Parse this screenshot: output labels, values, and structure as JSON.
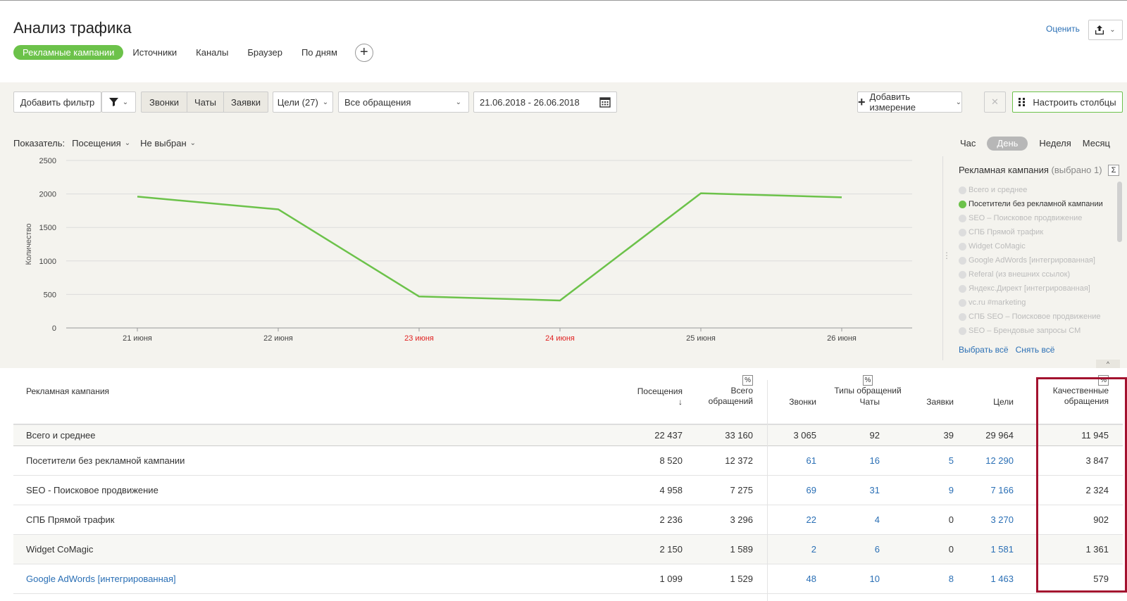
{
  "page": {
    "title": "Анализ трафика",
    "rate_label": "Оценить"
  },
  "tabs": [
    {
      "label": "Рекламные кампании",
      "active": true
    },
    {
      "label": "Источники"
    },
    {
      "label": "Каналы"
    },
    {
      "label": "Браузер"
    },
    {
      "label": "По дням"
    }
  ],
  "toolbar": {
    "add_filter": "Добавить фильтр",
    "segments": [
      "Звонки",
      "Чаты",
      "Заявки"
    ],
    "goals": "Цели (27)",
    "all_requests": "Все обращения",
    "date_range": "21.06.2018 - 26.06.2018",
    "add_dimension": "Добавить измерение",
    "configure_columns": "Настроить столбцы"
  },
  "indicator": {
    "label": "Показатель:",
    "metric1": "Посещения",
    "metric2": "Не выбран"
  },
  "periods": [
    "Час",
    "День",
    "Неделя",
    "Месяц"
  ],
  "active_period": "День",
  "chart_data": {
    "type": "line",
    "ylabel": "Количество",
    "ylim": [
      0,
      2500
    ],
    "yticks": [
      0,
      500,
      1000,
      1500,
      2000,
      2500
    ],
    "categories": [
      "21 июня",
      "22 июня",
      "23 июня",
      "24 июня",
      "25 июня",
      "26 июня"
    ],
    "weekend_categories": [
      "23 июня",
      "24 июня"
    ],
    "series": [
      {
        "name": "Посетители без рекламной кампании",
        "color": "#6cc24a",
        "values": [
          1960,
          1770,
          470,
          410,
          2010,
          1950
        ]
      }
    ],
    "grid": true,
    "legend_position": "right"
  },
  "legend": {
    "title": "Рекламная кампания",
    "selected": "(выбрано 1)",
    "sigma": "Σ",
    "items": [
      {
        "label": "Всего и среднее",
        "on": false
      },
      {
        "label": "Посетители без рекламной кампании",
        "on": true
      },
      {
        "label": "SEO – Поисковое продвижение",
        "on": false
      },
      {
        "label": "СПБ Прямой трафик",
        "on": false
      },
      {
        "label": "Widget CoMagic",
        "on": false
      },
      {
        "label": "Google AdWords [интегрированная]",
        "on": false
      },
      {
        "label": "Referal (из внешних ссылок)",
        "on": false
      },
      {
        "label": "Яндекс.Директ [интегрированная]",
        "on": false
      },
      {
        "label": "vc.ru #marketing",
        "on": false
      },
      {
        "label": "СПБ SEO – Поисковое продвижение",
        "on": false
      },
      {
        "label": "SEO – Брендовые запросы СМ",
        "on": false
      }
    ],
    "select_all": "Выбрать всё",
    "deselect_all": "Снять всё"
  },
  "table": {
    "headers": {
      "campaign": "Рекламная кампания",
      "visits": "Посещения",
      "sort_arrow": "↓",
      "total_requests_1": "Всего",
      "total_requests_2": "обращений",
      "types_group": "Типы обращений",
      "calls": "Звонки",
      "chats": "Чаты",
      "forms": "Заявки",
      "goals": "Цели",
      "quality_1": "Качественные",
      "quality_2": "обращения",
      "pct": "%"
    },
    "rows": [
      {
        "name": "Всего и среднее",
        "visits": "22 437",
        "total": "33 160",
        "calls": "3 065",
        "chats": "92",
        "forms": "39",
        "goals": "29 964",
        "quality": "11 945"
      },
      {
        "name": "Посетители без рекламной кампании",
        "visits": "8 520",
        "total": "12 372",
        "calls": "61",
        "chats": "16",
        "forms": "5",
        "goals": "12 290",
        "quality": "3 847"
      },
      {
        "name": "SEO - Поисковое продвижение",
        "visits": "4 958",
        "total": "7 275",
        "calls": "69",
        "chats": "31",
        "forms": "9",
        "goals": "7 166",
        "quality": "2 324"
      },
      {
        "name": "СПБ Прямой трафик",
        "visits": "2 236",
        "total": "3 296",
        "calls": "22",
        "chats": "4",
        "forms": "0",
        "goals": "3 270",
        "quality": "902"
      },
      {
        "name": "Widget CoMagic",
        "visits": "2 150",
        "total": "1 589",
        "calls": "2",
        "chats": "6",
        "forms": "0",
        "goals": "1 581",
        "quality": "1 361"
      },
      {
        "name": "Google AdWords [интегрированная]",
        "visits": "1 099",
        "total": "1 529",
        "calls": "48",
        "chats": "10",
        "forms": "8",
        "goals": "1 463",
        "quality": "579"
      }
    ]
  }
}
